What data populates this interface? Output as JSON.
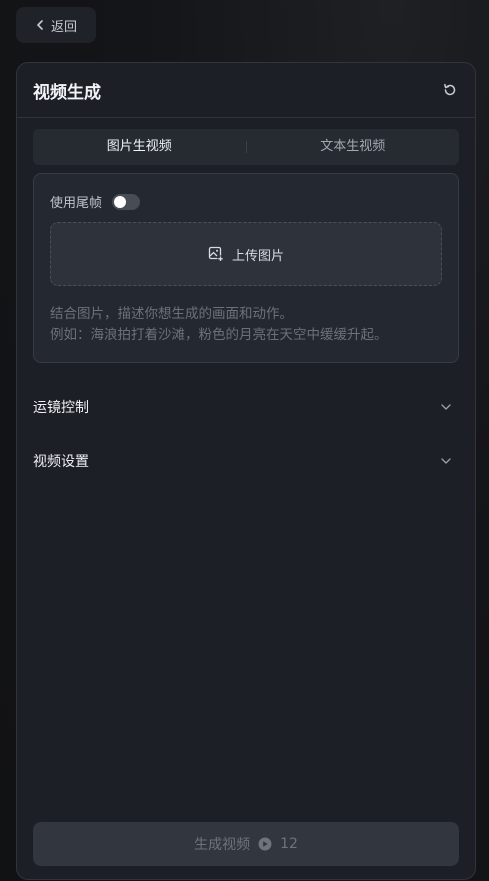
{
  "back": {
    "label": "返回"
  },
  "panel": {
    "title": "视频生成"
  },
  "tabs": [
    {
      "label": "图片生视频",
      "active": true
    },
    {
      "label": "文本生视频",
      "active": false
    }
  ],
  "image_mode": {
    "tail_frame_label": "使用尾帧",
    "tail_frame_enabled": false,
    "upload_label": "上传图片",
    "prompt_placeholder_line1": "结合图片，描述你想生成的画面和动作。",
    "prompt_placeholder_line2": "例如：海浪拍打着沙滩，粉色的月亮在天空中缓缓升起。"
  },
  "sections": [
    {
      "label": "运镜控制"
    },
    {
      "label": "视频设置"
    }
  ],
  "generate": {
    "label": "生成视频",
    "cost": "12"
  },
  "icons": {
    "back": "chevron-left-icon",
    "refresh": "refresh-icon",
    "upload": "image-add-icon",
    "expand": "chevron-down-icon",
    "coin": "coin-icon"
  }
}
